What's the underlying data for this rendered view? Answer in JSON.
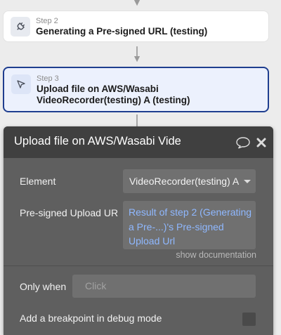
{
  "workflow": {
    "steps": [
      {
        "label": "Step 2",
        "title": "Generating a Pre-signed URL (testing)",
        "icon": "plug-icon"
      },
      {
        "label": "Step 3",
        "title": "Upload file on AWS/Wasabi VideoRecorder(testing) A (testing)",
        "icon": "cursor-icon",
        "active": true
      }
    ]
  },
  "panel": {
    "title": "Upload file on AWS/Wasabi Vide",
    "fields": {
      "element_label": "Element",
      "element_value": "VideoRecorder(testing) A",
      "presigned_label": "Pre-signed Upload UR",
      "presigned_value": "Result of step 2 (Generating a Pre-...)'s Pre-signed Upload Url",
      "show_documentation": "show documentation",
      "only_when_label": "Only when",
      "only_when_placeholder": "Click",
      "breakpoint_label": "Add a breakpoint in debug mode"
    },
    "colors": {
      "header": "#404040",
      "body": "#5f5f5f",
      "dynamic_text": "#8fb8ff",
      "active_step_border": "#1f3e8f"
    }
  }
}
